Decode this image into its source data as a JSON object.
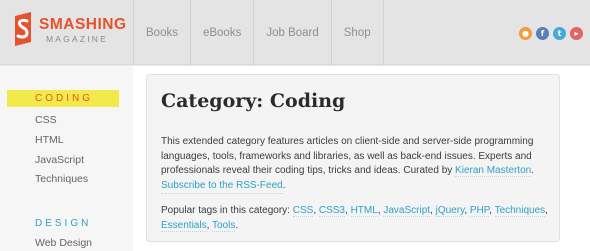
{
  "header": {
    "logo_word": "SMASHING",
    "logo_sub": "MAGAZINE",
    "nav": [
      "Books",
      "eBooks",
      "Job Board",
      "Shop"
    ],
    "social": [
      {
        "icon": "rss-icon",
        "glyph": "●",
        "color": "#f39c3c"
      },
      {
        "icon": "facebook-icon",
        "glyph": "f",
        "color": "#5a7fb8"
      },
      {
        "icon": "twitter-icon",
        "glyph": "t",
        "color": "#4aa8d8"
      },
      {
        "icon": "youtube-icon",
        "glyph": "▸",
        "color": "#e06565"
      }
    ]
  },
  "sidebar": {
    "sections": [
      {
        "heading": "CODING",
        "color": "#e5532d",
        "items": [
          "CSS",
          "HTML",
          "JavaScript",
          "Techniques"
        ]
      },
      {
        "heading": "DESIGN",
        "color": "#2ea0c6",
        "items": [
          "Web Design"
        ]
      }
    ]
  },
  "main": {
    "title": "Category: Coding",
    "desc_text": "This extended category features articles on client-side and server-side programming languages, tools, frameworks and libraries, as well as back-end issues. Experts and professionals reveal their coding tips, tricks and ideas. Curated by ",
    "curator": "Kieran Masterton",
    "rss_link": "Subscribe to the RSS-Feed",
    "tags_intro": "Popular tags in this category: ",
    "tags": [
      "CSS",
      "CSS3",
      "HTML",
      "JavaScript",
      "jQuery",
      "PHP",
      "Techniques",
      "Essentials",
      "Tools"
    ]
  }
}
